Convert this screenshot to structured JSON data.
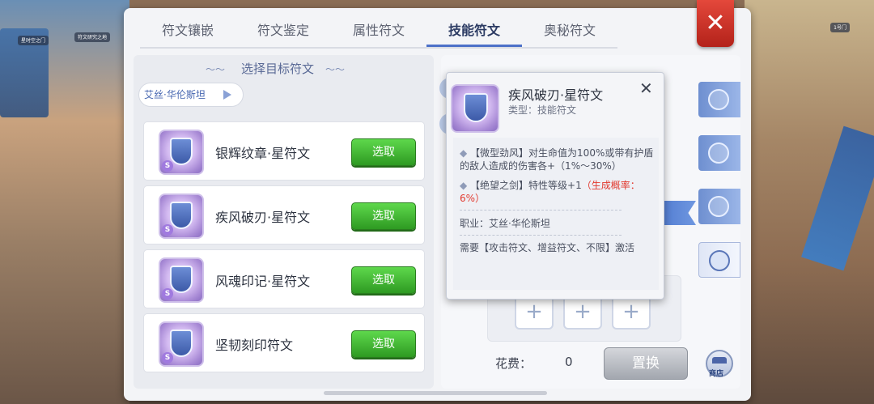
{
  "tabs": [
    {
      "label": "符文镶嵌"
    },
    {
      "label": "符文鉴定"
    },
    {
      "label": "属性符文"
    },
    {
      "label": "技能符文"
    },
    {
      "label": "奥秘符文"
    }
  ],
  "active_tab_index": 3,
  "close_icon": "close-icon",
  "list": {
    "section_title": "选择目标符文",
    "character": "艾丝·华伦斯坦",
    "items": [
      {
        "name": "银辉纹章·星符文",
        "button": "选取"
      },
      {
        "name": "疾风破刃·星符文",
        "button": "选取"
      },
      {
        "name": "风魂印记·星符文",
        "button": "选取"
      },
      {
        "name": "坚韧刻印符文",
        "button": "选取"
      }
    ]
  },
  "tooltip": {
    "title": "疾风破刃·星符文",
    "type": "类型：技能符文",
    "effect1": "【微型劲风】对生命值为100%或带有护盾的敌人造成的伤害各+（1%～30%）",
    "effect2_prefix": "【绝望之剑】特性等级+1",
    "effect2_chance": "（生成概率：6%）",
    "job": "职业：艾丝·华伦斯坦",
    "requirement": "需要【攻击符文、增益符文、不限】激活"
  },
  "bottom": {
    "cost_label": "花费：",
    "cost_value": "0",
    "replace_label": "置换",
    "shop_label": "商店"
  },
  "slots": [
    "+",
    "+",
    "+"
  ],
  "gem_letter": "S",
  "bg_tags": [
    "星时空之门",
    "符文研究之地",
    "1号门"
  ],
  "colors": {
    "accent_tab": "#4c70c8",
    "select_button": "#3fb830",
    "close_button": "#d23a2e",
    "chance_red": "#e23a2f"
  }
}
